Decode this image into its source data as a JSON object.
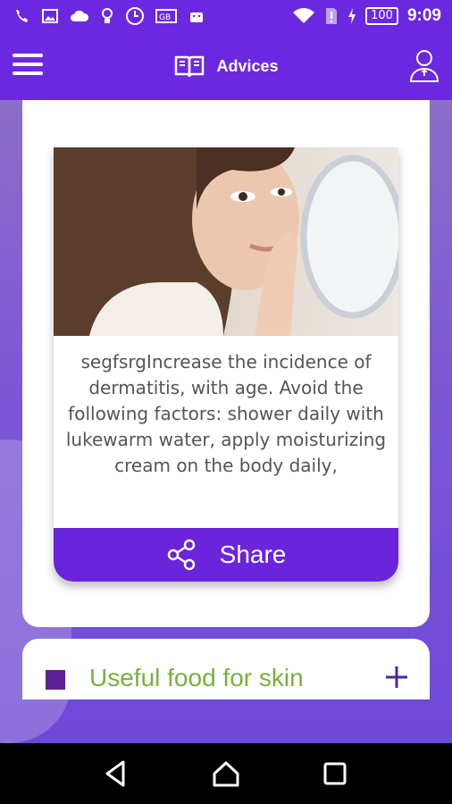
{
  "status_bar": {
    "battery": "100",
    "time": "9:09"
  },
  "toolbar": {
    "title": "Advices",
    "icons": [
      "menu-icon",
      "book-icon",
      "user-icon"
    ]
  },
  "advice": {
    "text": "segfsrgIncrease the incidence of dermatitis, with age. Avoid the following factors: shower daily with lukewarm water, apply moisturizing cream on the body daily,",
    "share_label": "Share",
    "share_icon": "share-icon"
  },
  "food_section": {
    "label": "Useful food for skin",
    "expand_icon": "plus-icon",
    "label_color": "#77b13d",
    "square_color": "#5e2196"
  },
  "colors": {
    "accent": "#6c28e0",
    "share_button": "#6a24dc"
  },
  "navigation": {
    "icons": [
      "back-icon",
      "home-icon",
      "recent-apps-icon"
    ]
  }
}
